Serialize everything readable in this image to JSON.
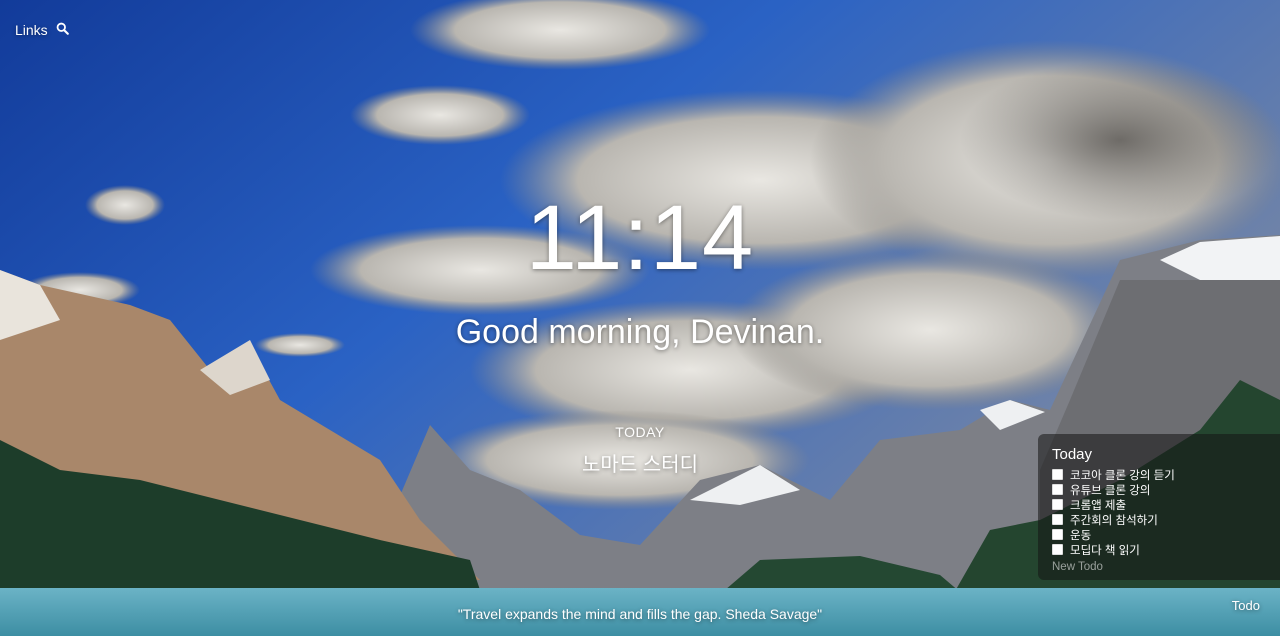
{
  "top_left": {
    "links_label": "Links",
    "search_icon": "search-icon"
  },
  "clock": {
    "time": "11:14"
  },
  "greeting": {
    "text": "Good morning, Devinan."
  },
  "focus": {
    "label": "TODAY",
    "value": "노마드 스터디"
  },
  "todo_panel": {
    "title": "Today",
    "items": [
      {
        "label": "코코아 클론 강의 듣기",
        "done": false
      },
      {
        "label": "유튜브 클론 강의",
        "done": false
      },
      {
        "label": "크롬앱 제출",
        "done": false
      },
      {
        "label": "주간회의 참석하기",
        "done": false
      },
      {
        "label": "운동",
        "done": false
      },
      {
        "label": "모딥다 책 읽기",
        "done": false
      }
    ],
    "new_placeholder": "New Todo"
  },
  "quote": {
    "text": "\"Travel expands the mind and fills the gap. Sheda Savage\""
  },
  "todo_toggle": {
    "label": "Todo"
  },
  "colors": {
    "text": "#ffffff",
    "sky": "#1a4aa8",
    "lake": "#5fa4b8"
  }
}
